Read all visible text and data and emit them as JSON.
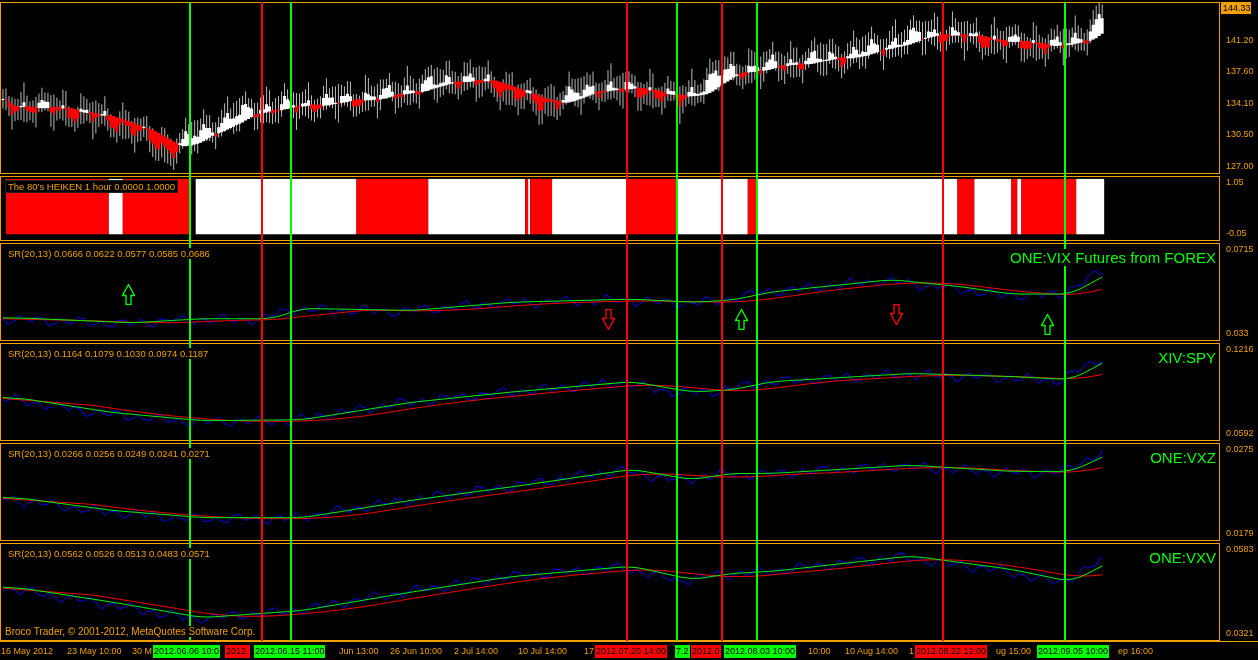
{
  "price_pane": {
    "scale": [
      "144.33",
      "141.20",
      "137.60",
      "134.10",
      "130.50",
      "127.00"
    ]
  },
  "heiken_pane": {
    "label": "The 80's HEIKEN 1 hour 0.0000 1.0000",
    "scale": [
      "1.05",
      "-0.05"
    ]
  },
  "panes": [
    {
      "label": "SR(20,13) 0.0666 0.0622 0.0577 0.0585 0.0686",
      "symbol": "ONE:VIX Futures from FOREX",
      "scale": [
        "0.0715",
        "0.033"
      ]
    },
    {
      "label": "SR(20,13) 0.1164 0.1079 0.1030 0.0974 0.1187",
      "symbol": "XIV:SPY",
      "scale": [
        "0.1216",
        "0.0592"
      ]
    },
    {
      "label": "SR(20,13) 0.0266 0.0256 0.0249 0.0241 0.0271",
      "symbol": "ONE:VXZ",
      "scale": [
        "0.0275",
        "0.0179"
      ]
    },
    {
      "label": "SR(20,13) 0.0562 0.0526 0.0513 0.0483 0.0571",
      "symbol": "ONE:VXV",
      "scale": [
        "0.0583",
        "0.0321"
      ]
    }
  ],
  "copyright": "Broco Trader, © 2001-2012, MetaQuotes Software Corp.",
  "time_axis": [
    {
      "text": "16 May 2012",
      "kind": "plain"
    },
    {
      "text": "23 May 10:00",
      "kind": "plain"
    },
    {
      "text": "30 M",
      "kind": "plain"
    },
    {
      "text": "2012.06.06 10:0",
      "kind": "green"
    },
    {
      "text": "2012.",
      "kind": "red"
    },
    {
      "text": "2012.06.15 11:00",
      "kind": "green"
    },
    {
      "text": "Jun 13:00",
      "kind": "plain"
    },
    {
      "text": "26 Jun 10:00",
      "kind": "plain"
    },
    {
      "text": "2 Jul 14:00",
      "kind": "plain"
    },
    {
      "text": "10 Jul 14:00",
      "kind": "plain"
    },
    {
      "text": "17",
      "kind": "plain"
    },
    {
      "text": "2012.07.20 14:00",
      "kind": "red"
    },
    {
      "text": "7.2",
      "kind": "green"
    },
    {
      "text": "2012.0",
      "kind": "red"
    },
    {
      "text": "2012.08.03 10:00",
      "kind": "green"
    },
    {
      "text": "10:00",
      "kind": "plain"
    },
    {
      "text": "10 Aug 14:00",
      "kind": "plain"
    },
    {
      "text": "1",
      "kind": "plain"
    },
    {
      "text": "2012.08.22 12:00",
      "kind": "red"
    },
    {
      "text": "ug 15:00",
      "kind": "plain"
    },
    {
      "text": "2012.09.05 10:00",
      "kind": "green"
    },
    {
      "text": "ep 16:00",
      "kind": "plain"
    }
  ]
}
